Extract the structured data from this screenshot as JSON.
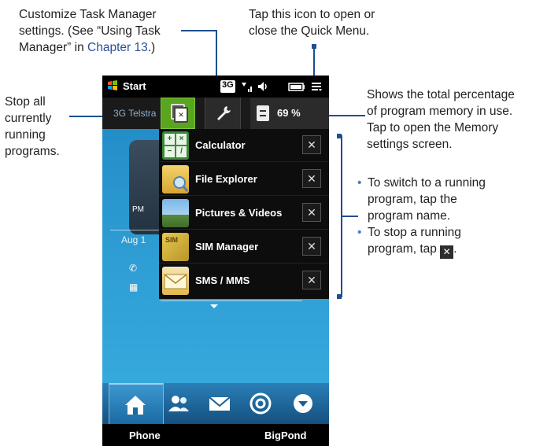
{
  "callouts": {
    "customize_line1": "Customize Task Manager",
    "customize_line2": "settings. (See “Using Task",
    "customize_line3_a": "Manager” in ",
    "customize_line3_b": "Chapter 13",
    "customize_line3_c": ".)",
    "quickmenu_line1": "Tap this icon to open or",
    "quickmenu_line2": "close the Quick Menu.",
    "stopall_line1": "Stop all",
    "stopall_line2": "currently",
    "stopall_line3": "running",
    "stopall_line4": "programs.",
    "memory_line1": "Shows the total percentage",
    "memory_line2": "of program memory in use.",
    "memory_line3": "Tap to open the Memory",
    "memory_line4": "settings screen.",
    "bullet1_line1": "To switch to a running",
    "bullet1_line2": "program, tap the",
    "bullet1_line3": "program name.",
    "bullet2_line1": "To stop a running",
    "bullet2_line2": "program, tap",
    "bullet2_suffix": "."
  },
  "statusbar": {
    "start_label": "Start",
    "network_badge": "3G"
  },
  "task_manager": {
    "carrier": "3G Telstra",
    "memory_percent": "69 %"
  },
  "home_widget": {
    "pm": "PM",
    "date_fragment": "Aug 1"
  },
  "programs": [
    {
      "name": "Calculator",
      "icon": "calculator-icon"
    },
    {
      "name": "File Explorer",
      "icon": "file-explorer-icon"
    },
    {
      "name": "Pictures & Videos",
      "icon": "pictures-videos-icon"
    },
    {
      "name": "SIM Manager",
      "icon": "sim-manager-icon"
    },
    {
      "name": "SMS / MMS",
      "icon": "sms-mms-icon"
    }
  ],
  "close_glyph": "✕",
  "softkeys": {
    "left": "Phone",
    "right": "BigPond"
  },
  "colors": {
    "accent_green": "#5aa51e",
    "leader_blue": "#1d4f8f",
    "link_blue": "#2a4f97"
  }
}
